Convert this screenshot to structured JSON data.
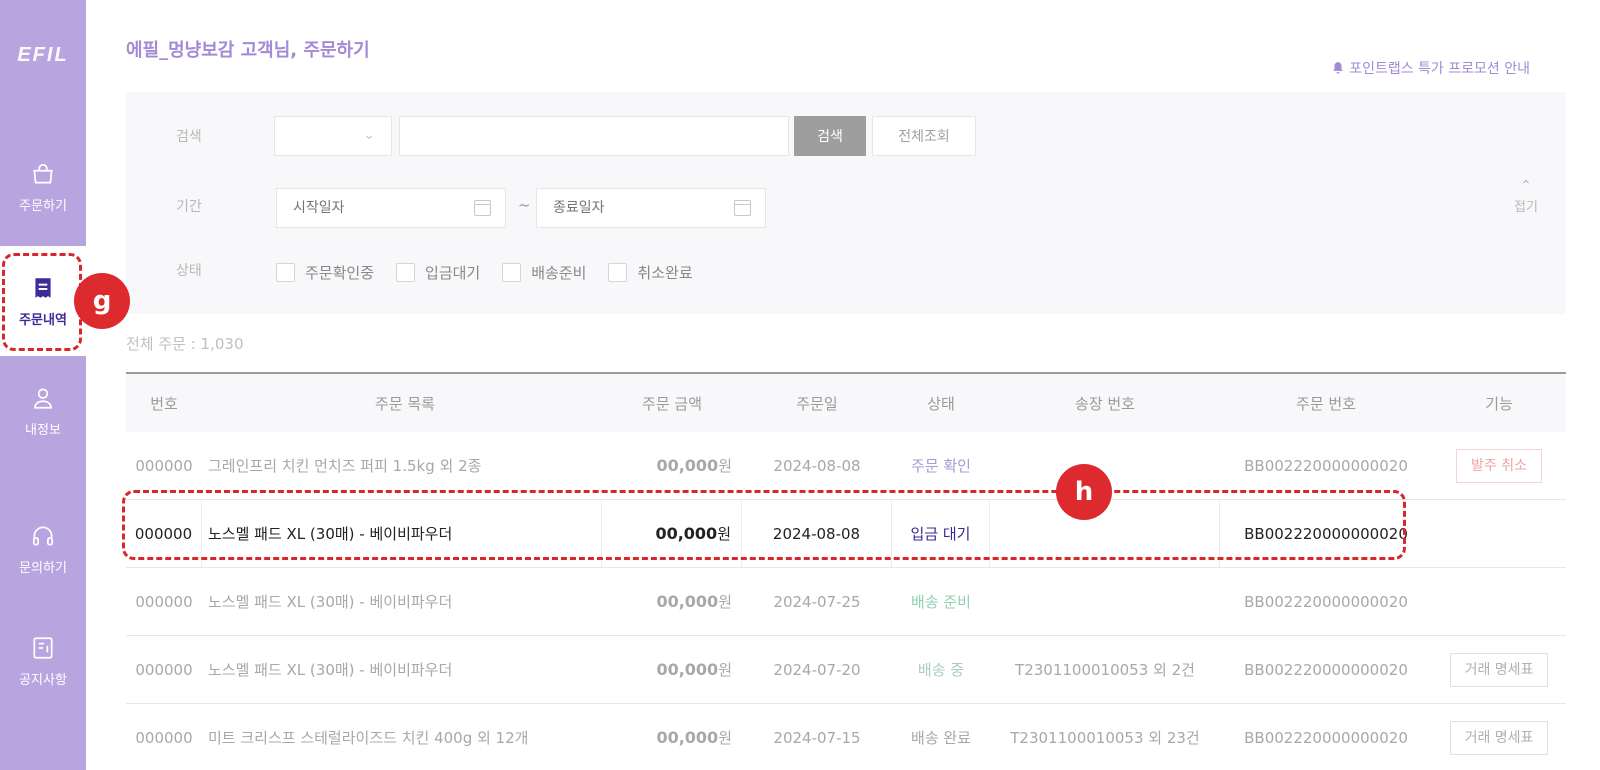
{
  "sidebar": {
    "logo": "EFIL",
    "items": [
      {
        "label": "주문하기",
        "icon": "shopping-bag-icon"
      },
      {
        "label": "주문내역",
        "icon": "receipt-icon",
        "active": true
      },
      {
        "label": "내정보",
        "icon": "user-icon"
      },
      {
        "label": "문의하기",
        "icon": "headphones-icon"
      },
      {
        "label": "공지사항",
        "icon": "notice-icon"
      }
    ]
  },
  "header": {
    "title": "에필_멍냥보감 고객님, 주문하기",
    "promo": "포인트랩스 특가 프로모션 안내"
  },
  "filter": {
    "search_label": "검색",
    "search_value": "",
    "search_button": "검색",
    "all_button": "전체조회",
    "period_label": "기간",
    "start_placeholder": "시작일자",
    "tilde": "~",
    "end_placeholder": "종료일자",
    "status_label": "상태",
    "statuses": [
      "주문확인중",
      "입금대기",
      "배송준비",
      "취소완료"
    ],
    "collapse_label": "접기"
  },
  "summary": {
    "total": "전체 주문 : 1,030"
  },
  "table": {
    "headers": [
      "번호",
      "주문 목록",
      "주문 금액",
      "주문일",
      "상태",
      "송장 번호",
      "주문 번호",
      "기능"
    ],
    "currency": "원",
    "rows": [
      {
        "no": "000000",
        "item": "그레인프리 치킨 먼치즈 퍼피 1.5kg 외 2종",
        "amount": "00,000",
        "date": "2024-08-08",
        "status": "주문 확인",
        "invoice": "",
        "order_no": "BB002220000000020",
        "action": "발주 취소"
      },
      {
        "no": "000000",
        "item": "노스멜 패드 XL (30매) - 베이비파우더",
        "amount": "00,000",
        "date": "2024-08-08",
        "status": "입금 대기",
        "invoice": "",
        "order_no": "BB002220000000020",
        "action": ""
      },
      {
        "no": "000000",
        "item": "노스멜 패드 XL (30매) - 베이비파우더",
        "amount": "00,000",
        "date": "2024-07-25",
        "status": "배송 준비",
        "invoice": "",
        "order_no": "BB002220000000020",
        "action": ""
      },
      {
        "no": "000000",
        "item": "노스멜 패드 XL (30매) - 베이비파우더",
        "amount": "00,000",
        "date": "2024-07-20",
        "status": "배송 중",
        "invoice": "T2301100010053 외 2건",
        "order_no": "BB002220000000020",
        "action": "거래 명세표"
      },
      {
        "no": "000000",
        "item": "미트 크리스프 스테럴라이즈드 치킨 400g 외 12개",
        "amount": "00,000",
        "date": "2024-07-15",
        "status": "배송 완료",
        "invoice": "T2301100010053 외 23건",
        "order_no": "BB002220000000020",
        "action": "거래 명세표"
      }
    ]
  },
  "annotations": {
    "g": "g",
    "h": "h",
    "color": "#d8262c"
  }
}
